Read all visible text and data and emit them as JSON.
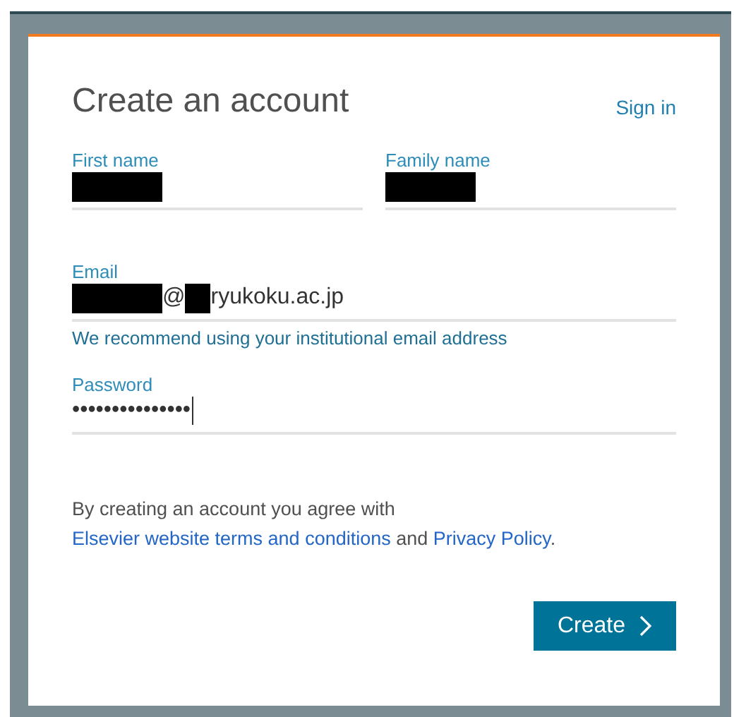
{
  "title": "Create an account",
  "sign_in": "Sign in",
  "name_fields": [
    {
      "label": "First name",
      "value_parts": [
        {
          "kind": "redacted"
        }
      ]
    },
    {
      "label": "Family name",
      "value_parts": [
        {
          "kind": "redacted"
        }
      ]
    }
  ],
  "fields": [
    {
      "label": "Email",
      "value_parts": [
        {
          "kind": "redacted"
        },
        {
          "kind": "text",
          "text": "@"
        },
        {
          "kind": "stub"
        },
        {
          "kind": "text",
          "text": "ryukoku.ac.jp"
        }
      ],
      "hint": "We recommend using your institutional email address"
    },
    {
      "label": "Password",
      "value_parts": [
        {
          "kind": "text",
          "text": "•••••••••••••••"
        }
      ],
      "focused": true
    }
  ],
  "terms": [
    {
      "kind": "text",
      "text": "By creating an account you agree with "
    },
    {
      "kind": "link",
      "text": "Elsevier website terms and conditions"
    },
    {
      "kind": "text",
      "text": " and "
    },
    {
      "kind": "link",
      "text": "Privacy Policy"
    },
    {
      "kind": "text",
      "text": "."
    }
  ],
  "button": {
    "label": "Create"
  }
}
